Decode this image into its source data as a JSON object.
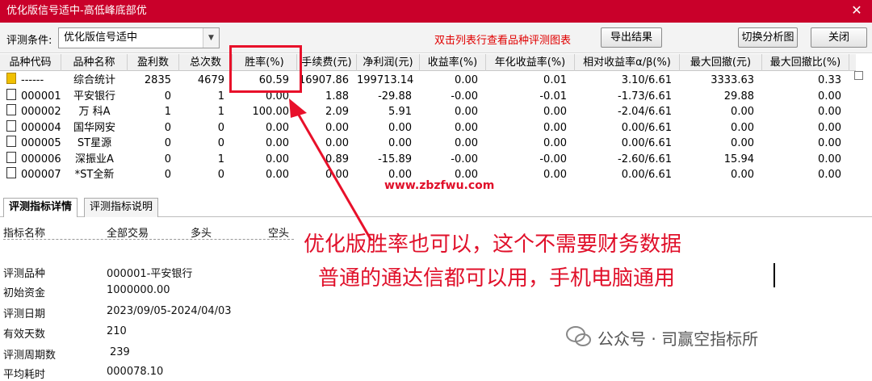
{
  "window": {
    "title": "优化版信号适中-高低峰底部优",
    "close_glyph": "✕"
  },
  "toolbar": {
    "criteria_label": "评测条件:",
    "criteria_value": "优化版信号适中",
    "hint": "双击列表行查看品种评测图表",
    "export_label": "导出结果",
    "switch_label": "切换分析图",
    "close_label": "关闭"
  },
  "grid": {
    "columns": [
      "品种代码",
      "品种名称",
      "盈利数",
      "总次数",
      "胜率(%)",
      "手续费(元)",
      "净利润(元)",
      "收益率(%)",
      "年化收益率(%)",
      "相对收益率α/β(%)",
      "最大回撤(元)",
      "最大回撤比(%)"
    ],
    "rows": [
      [
        "------",
        "综合统计",
        "2835",
        "4679",
        "60.59",
        "16907.86",
        "199713.14",
        "0.00",
        "0.01",
        "3.10/6.61",
        "3333.63",
        "0.33"
      ],
      [
        "000001",
        "平安银行",
        "0",
        "1",
        "0.00",
        "1.88",
        "-29.88",
        "-0.00",
        "-0.01",
        "-1.73/6.61",
        "29.88",
        "0.00"
      ],
      [
        "000002",
        "万 科A",
        "1",
        "1",
        "100.00",
        "2.09",
        "5.91",
        "0.00",
        "0.00",
        "-2.04/6.61",
        "0.00",
        "0.00"
      ],
      [
        "000004",
        "国华网安",
        "0",
        "0",
        "0.00",
        "0.00",
        "0.00",
        "0.00",
        "0.00",
        "0.00/6.61",
        "0.00",
        "0.00"
      ],
      [
        "000005",
        "ST星源",
        "0",
        "0",
        "0.00",
        "0.00",
        "0.00",
        "0.00",
        "0.00",
        "0.00/6.61",
        "0.00",
        "0.00"
      ],
      [
        "000006",
        "深振业A",
        "0",
        "1",
        "0.00",
        "0.89",
        "-15.89",
        "-0.00",
        "-0.00",
        "-2.60/6.61",
        "15.94",
        "0.00"
      ],
      [
        "000007",
        "*ST全新",
        "0",
        "0",
        "0.00",
        "0.00",
        "0.00",
        "0.00",
        "0.00",
        "0.00/6.61",
        "0.00",
        "0.00"
      ]
    ]
  },
  "tabs": [
    "评测指标详情",
    "评测指标说明"
  ],
  "detail": {
    "headers": [
      "指标名称",
      "全部交易",
      "多头",
      "空头"
    ],
    "rows": [
      [
        "评测品种",
        "000001-平安银行"
      ],
      [
        "初始资金",
        "1000000.00"
      ],
      [
        "评测日期",
        "2023/09/05-2024/04/03"
      ],
      [
        "有效天数",
        "210"
      ],
      [
        "评测周期数",
        "239"
      ],
      [
        "平均耗时",
        "000078.10"
      ]
    ]
  },
  "annotation": {
    "line1": "优化版胜率也可以，这个不需要财务数据",
    "line2": "普通的通达信都可以用，手机电脑通用",
    "watermark": "www.zbzfwu.com",
    "wechat": "公众号 · 司赢空指标所",
    "accent": "#e0102a"
  }
}
